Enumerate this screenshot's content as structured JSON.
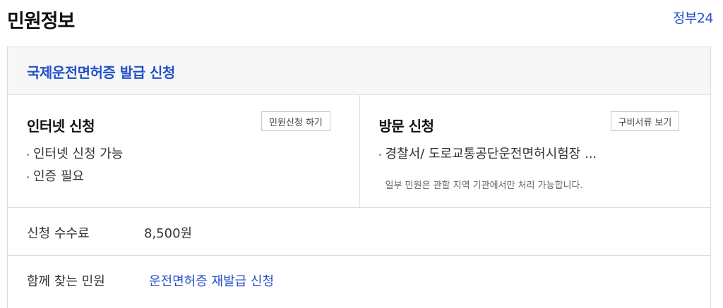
{
  "header": {
    "title": "민원정보",
    "gov_link": "정부24"
  },
  "service": {
    "title": "국제운전면허증 발급 신청"
  },
  "internet": {
    "title": "인터넷 신청",
    "button_label": "민원신청 하기",
    "items": [
      "인터넷 신청 가능",
      "인증 필요"
    ]
  },
  "visit": {
    "title": "방문 신청",
    "button_label": "구비서류 보기",
    "items": [
      "경찰서/ 도로교통공단운전면허시험장 ..."
    ],
    "note": "일부 민원은 관할 지역 기관에서만 처리 가능합니다."
  },
  "fee": {
    "label": "신청 수수료",
    "value": "8,500원"
  },
  "related": {
    "label": "함께 찾는 민원",
    "link": "운전면허증 재발급 신청"
  }
}
